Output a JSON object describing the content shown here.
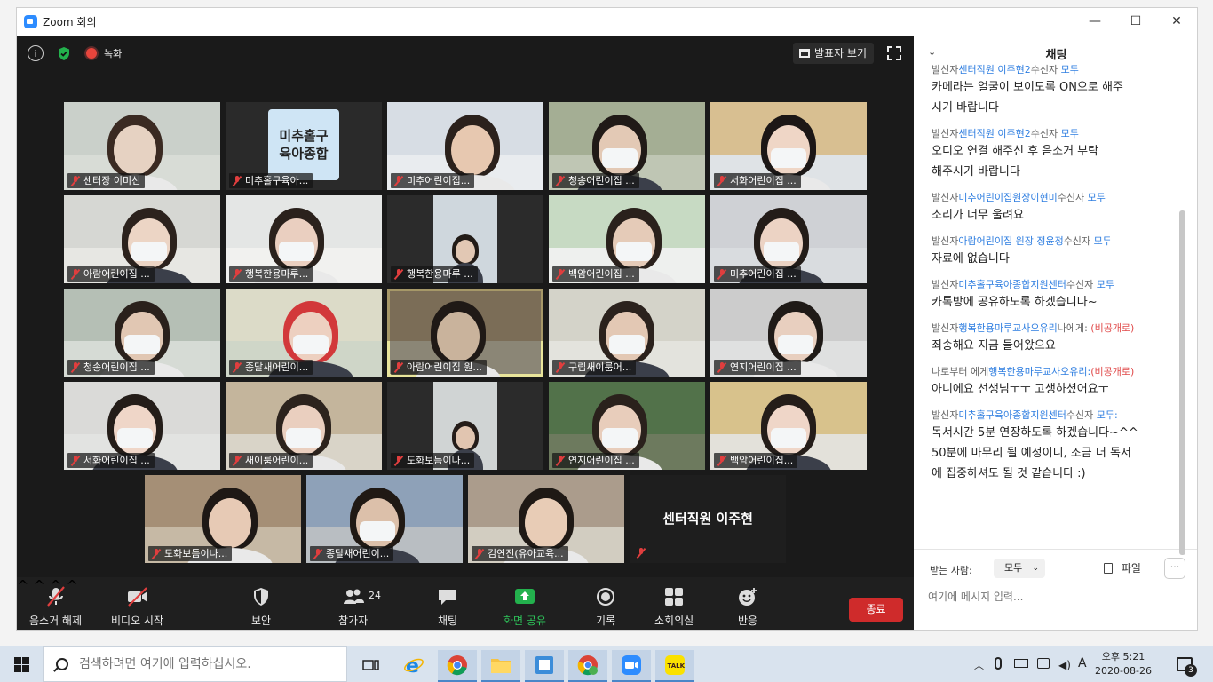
{
  "window": {
    "title": "Zoom 회의",
    "minimize": "—",
    "maximize": "☐",
    "close": "✕"
  },
  "meeting_top": {
    "info": "i",
    "record_label": "녹화",
    "speaker_view": "발표자 보기"
  },
  "tiles": [
    {
      "name": "센터장 이미선"
    },
    {
      "name": "미추홀구육아...",
      "logo_line1": "미추홀구",
      "logo_line2": "육아종합"
    },
    {
      "name": "미추어린이집..."
    },
    {
      "name": "청송어린이집 ..."
    },
    {
      "name": "서화어린이집 ..."
    },
    {
      "name": "아람어린이집 ..."
    },
    {
      "name": "행복한용마루..."
    },
    {
      "name": "행복한용마루 ..."
    },
    {
      "name": "백암어린이집 ..."
    },
    {
      "name": "미추어린이집 ..."
    },
    {
      "name": "청송어린이집 ..."
    },
    {
      "name": "종달새어린이..."
    },
    {
      "name": "아람어린이집 원..."
    },
    {
      "name": "구립새이룸어..."
    },
    {
      "name": "연지어린이집 ..."
    },
    {
      "name": "서화어린이집 ..."
    },
    {
      "name": "새이룸어린이..."
    },
    {
      "name": "도화보듬이나..."
    },
    {
      "name": "연지어린이집 ..."
    },
    {
      "name": "백암어린이집..."
    },
    {
      "name": "도화보듬이나..."
    },
    {
      "name": "종달새어린이..."
    },
    {
      "name": "김연진(유아교육..."
    },
    {
      "name": "센터직원 이주현"
    }
  ],
  "toolbar": {
    "mute": "음소거 해제",
    "video": "비디오 시작",
    "security": "보안",
    "participants": "참가자",
    "participants_count": "24",
    "chat": "채팅",
    "share": "화면 공유",
    "record": "기록",
    "breakout": "소회의실",
    "reactions": "반응",
    "end": "종료",
    "caret": "^"
  },
  "chat": {
    "header": "채팅",
    "chev": "⌄",
    "messages": [
      {
        "sender_prefix": "발신자",
        "sender": "센터직원 이주현2",
        "to_prefix": "수신자",
        "to": "모두",
        "text": "카메라는 얼굴이 보이도록 ON으로 해주\n시기 바랍니다"
      },
      {
        "sender_prefix": "발신자",
        "sender": "센터직원 이주현2",
        "to_prefix": "수신자",
        "to": "모두",
        "text": "오디오 연결 해주신 후 음소거 부탁\n해주시기 바랍니다"
      },
      {
        "sender_prefix": "발신자",
        "sender": "미추어린이집원장이현미",
        "to_prefix": "수신자",
        "to": "모두",
        "text": "소리가 너무 울려요"
      },
      {
        "sender_prefix": "발신자",
        "sender": "아람어린이집 원장 정윤정",
        "to_prefix": "수신자",
        "to": "모두",
        "text": "자료에 없습니다"
      },
      {
        "sender_prefix": "발신자",
        "sender": "미추홀구육아종합지원센터",
        "to_prefix": "수신자",
        "to": "모두",
        "text": "카톡방에 공유하도록 하겠습니다~"
      },
      {
        "sender_prefix": "발신자",
        "sender": "행복한용마루교사오유리",
        "to_prefix": "나에게:",
        "to": "",
        "private": "(비공개로)",
        "text": "죄송해요 지금 들어왔으요"
      },
      {
        "sender_prefix": "나로부터 에게",
        "sender": "행복한용마루교사오유리:",
        "to_prefix": "",
        "to": "",
        "private": "(비공개로)",
        "text": "아니에요 선생님ㅜㅜ 고생하셨어요ㅜ"
      },
      {
        "sender_prefix": "발신자",
        "sender": "미추홀구육아종합지원센터",
        "to_prefix": "수신자",
        "to": "모두:",
        "text": "독서시간 5분 연장하도록 하겠습니다~^^\n50분에 마무리 될 예정이니, 조금 더 독서\n에 집중하셔도 될 것 같습니다 :)"
      }
    ],
    "to_label": "받는 사람:",
    "to_value": "모두",
    "file_label": "파일",
    "more": "···",
    "input_placeholder": "여기에 메시지 입력..."
  },
  "taskbar": {
    "search_placeholder": "검색하려면 여기에 입력하십시오.",
    "ime": "A",
    "clock_time": "오후 5:21",
    "clock_date": "2020-08-26",
    "notif_count": "3"
  }
}
